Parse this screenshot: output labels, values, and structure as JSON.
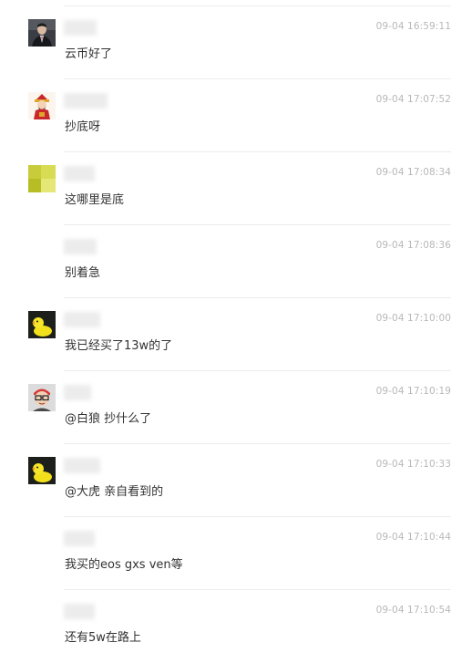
{
  "comments": [
    {
      "avatar": "businessman-avatar",
      "time": "09-04 16:59:11",
      "text": "云币好了"
    },
    {
      "avatar": "caishen-avatar",
      "time": "09-04 17:07:52",
      "text": "抄底呀"
    },
    {
      "avatar": "yellow-green-blocks-avatar",
      "time": "09-04 17:08:34",
      "text": "这哪里是底"
    },
    {
      "avatar": "none",
      "time": "09-04 17:08:36",
      "text": "别着急"
    },
    {
      "avatar": "yellow-duck-avatar",
      "time": "09-04 17:10:00",
      "text": "我已经买了13w的了"
    },
    {
      "avatar": "cartoon-glasses-avatar",
      "time": "09-04 17:10:19",
      "text": "@白狼   抄什么了"
    },
    {
      "avatar": "yellow-duck-avatar",
      "time": "09-04 17:10:33",
      "text": "@大虎 亲自看到的"
    },
    {
      "avatar": "none",
      "time": "09-04 17:10:44",
      "text": "我买的eos gxs ven等"
    },
    {
      "avatar": "none",
      "time": "09-04 17:10:54",
      "text": "还有5w在路上"
    }
  ]
}
